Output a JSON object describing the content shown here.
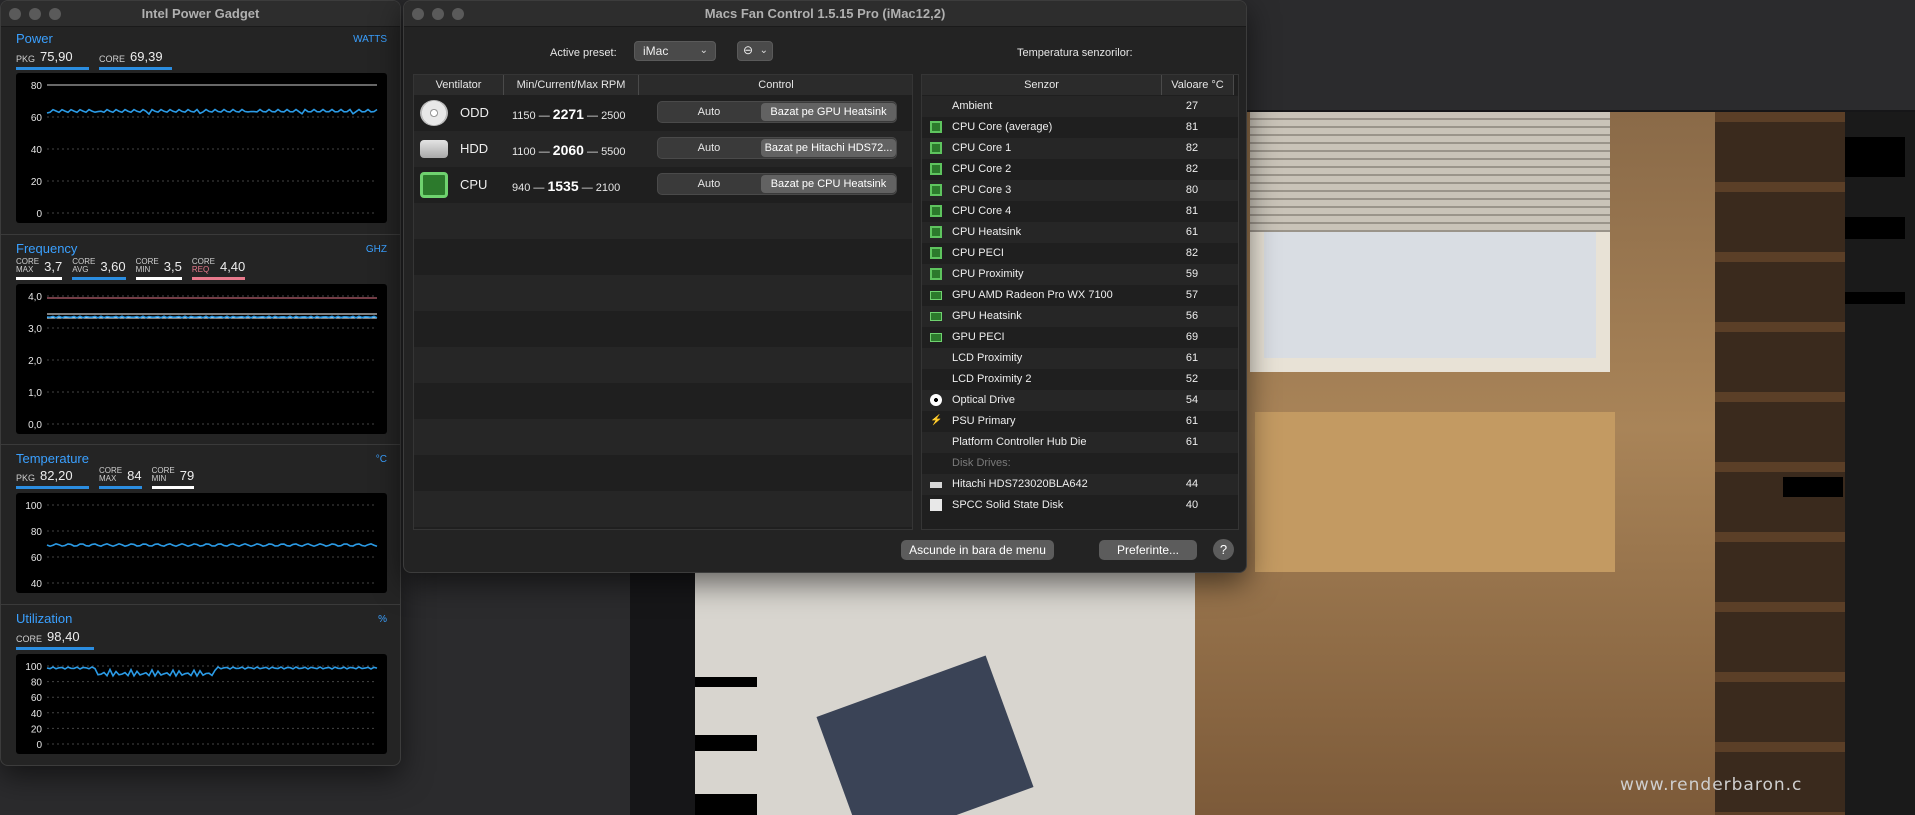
{
  "desktop": {
    "watermark": "www.renderbaron.c"
  },
  "ipg": {
    "title": "Intel Power Gadget",
    "power": {
      "title": "Power",
      "unit": "WATTS",
      "readouts": [
        {
          "label": "PKG",
          "value": "75,90"
        },
        {
          "label": "CORE",
          "value": "69,39"
        }
      ],
      "yticks": [
        "80",
        "60",
        "40",
        "20",
        "0"
      ]
    },
    "frequency": {
      "title": "Frequency",
      "unit": "GHZ",
      "readouts": [
        {
          "l1": "CORE",
          "l2": "MAX",
          "value": "3,7"
        },
        {
          "l1": "CORE",
          "l2": "AVG",
          "value": "3,60"
        },
        {
          "l1": "CORE",
          "l2": "MIN",
          "value": "3,5"
        },
        {
          "l1": "CORE",
          "l2": "REQ",
          "value": "4,40"
        }
      ],
      "yticks": [
        "4,0",
        "3,0",
        "2,0",
        "1,0",
        "0,0"
      ]
    },
    "temperature": {
      "title": "Temperature",
      "unit": "°C",
      "readouts": [
        {
          "label": "PKG",
          "value": "82,20"
        },
        {
          "l1": "CORE",
          "l2": "MAX",
          "value": "84"
        },
        {
          "l1": "CORE",
          "l2": "MIN",
          "value": "79"
        }
      ],
      "yticks": [
        "100",
        "80",
        "60",
        "40"
      ]
    },
    "utilization": {
      "title": "Utilization",
      "unit": "%",
      "readouts": [
        {
          "label": "CORE",
          "value": "98,40"
        }
      ],
      "yticks": [
        "100",
        "80",
        "60",
        "40",
        "20",
        "0"
      ]
    },
    "colors": {
      "accent": "#3aa0ff",
      "line": "#2b8de0",
      "max": "#ffffff",
      "req": "#e87a8c"
    }
  },
  "mfc": {
    "title": "Macs Fan Control 1.5.15 Pro (iMac12,2)",
    "active_preset_label": "Active preset:",
    "preset_value": "iMac",
    "more_button": "⊖",
    "sensors_title": "Temperatura senzorilor:",
    "fan_headers": [
      "Ventilator",
      "Min/Current/Max RPM",
      "Control"
    ],
    "fans": [
      {
        "name": "ODD",
        "icon": "optical-drive-icon",
        "min": "1150",
        "current": "2271",
        "max": "2500",
        "mode": "Auto",
        "control": "Bazat pe GPU Heatsink"
      },
      {
        "name": "HDD",
        "icon": "hard-drive-icon",
        "min": "1100",
        "current": "2060",
        "max": "5500",
        "mode": "Auto",
        "control": "Bazat pe Hitachi HDS72..."
      },
      {
        "name": "CPU",
        "icon": "cpu-chip-icon",
        "min": "940",
        "current": "1535",
        "max": "2100",
        "mode": "Auto",
        "control": "Bazat pe CPU Heatsink"
      }
    ],
    "sensor_headers": [
      "Senzor",
      "Valoare °C"
    ],
    "sensors": [
      {
        "icon": "none",
        "name": "Ambient",
        "value": "27"
      },
      {
        "icon": "chip",
        "name": "CPU Core (average)",
        "value": "81"
      },
      {
        "icon": "chip",
        "name": "CPU Core 1",
        "value": "82"
      },
      {
        "icon": "chip",
        "name": "CPU Core 2",
        "value": "82"
      },
      {
        "icon": "chip",
        "name": "CPU Core 3",
        "value": "80"
      },
      {
        "icon": "chip",
        "name": "CPU Core 4",
        "value": "81"
      },
      {
        "icon": "chip",
        "name": "CPU Heatsink",
        "value": "61"
      },
      {
        "icon": "chip",
        "name": "CPU PECI",
        "value": "82"
      },
      {
        "icon": "chip",
        "name": "CPU Proximity",
        "value": "59"
      },
      {
        "icon": "gpu",
        "name": "GPU AMD Radeon Pro WX 7100",
        "value": "57"
      },
      {
        "icon": "gpu",
        "name": "GPU Heatsink",
        "value": "56"
      },
      {
        "icon": "gpu",
        "name": "GPU PECI",
        "value": "69"
      },
      {
        "icon": "none",
        "name": "LCD Proximity",
        "value": "61"
      },
      {
        "icon": "none",
        "name": "LCD Proximity 2",
        "value": "52"
      },
      {
        "icon": "disc",
        "name": "Optical Drive",
        "value": "54"
      },
      {
        "icon": "bolt",
        "name": "PSU Primary",
        "value": "61"
      },
      {
        "icon": "none",
        "name": "Platform Controller Hub Die",
        "value": "61"
      },
      {
        "icon": "group",
        "name": "Disk Drives:",
        "value": ""
      },
      {
        "icon": "hdd",
        "name": "Hitachi HDS723020BLA642",
        "value": "44"
      },
      {
        "icon": "ssd",
        "name": "SPCC Solid State Disk",
        "value": "40"
      }
    ],
    "hide_button": "Ascunde in bara de menu",
    "prefs_button": "Preferinte...",
    "help_button": "?"
  }
}
